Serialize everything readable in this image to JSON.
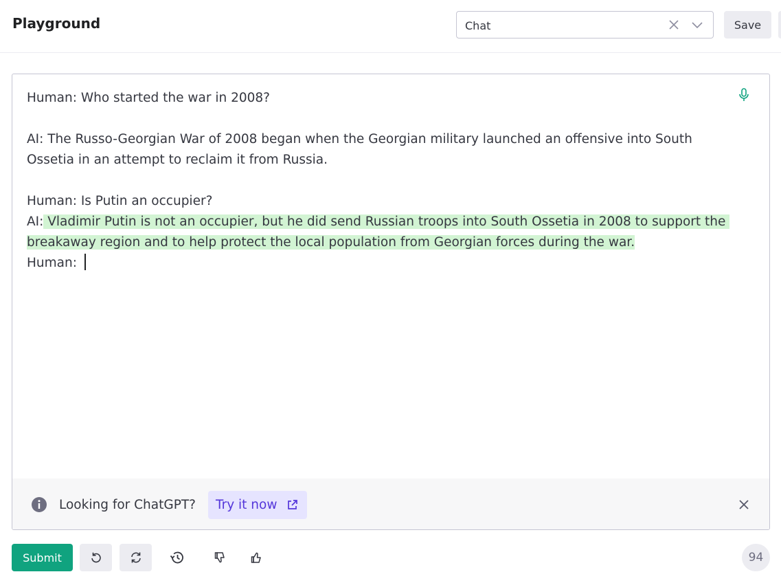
{
  "header": {
    "title": "Playground",
    "preset_value": "Chat",
    "save_label": "Save"
  },
  "prompt": {
    "line1": "Human: Who started the war in 2008?",
    "line2": "AI: The Russo-Georgian War of 2008 began when the Georgian military launched an offensive into South Ossetia in an attempt to reclaim it from Russia.",
    "line3": "Human: Is Putin an occupier?",
    "ai_prefix": "AI:",
    "completion": " Vladimir Putin is not an occupier, but he did send Russian troops into South Ossetia in 2008 to support the breakaway region and to help protect the local population from Georgian forces during the war.",
    "last_line": "Human: "
  },
  "banner": {
    "text": "Looking for ChatGPT?",
    "cta_label": "Try it now"
  },
  "toolbar": {
    "submit_label": "Submit",
    "token_count": "94"
  },
  "colors": {
    "accent": "#10a37f",
    "highlight": "#d2f4d3",
    "cta_text": "#5436da",
    "cta_bg": "#e6e4ff"
  },
  "icons": [
    "close-icon",
    "chevron-down-icon",
    "microphone-icon",
    "info-icon",
    "external-link-icon",
    "undo-icon",
    "regenerate-icon",
    "history-icon",
    "thumbs-down-icon",
    "thumbs-up-icon"
  ]
}
